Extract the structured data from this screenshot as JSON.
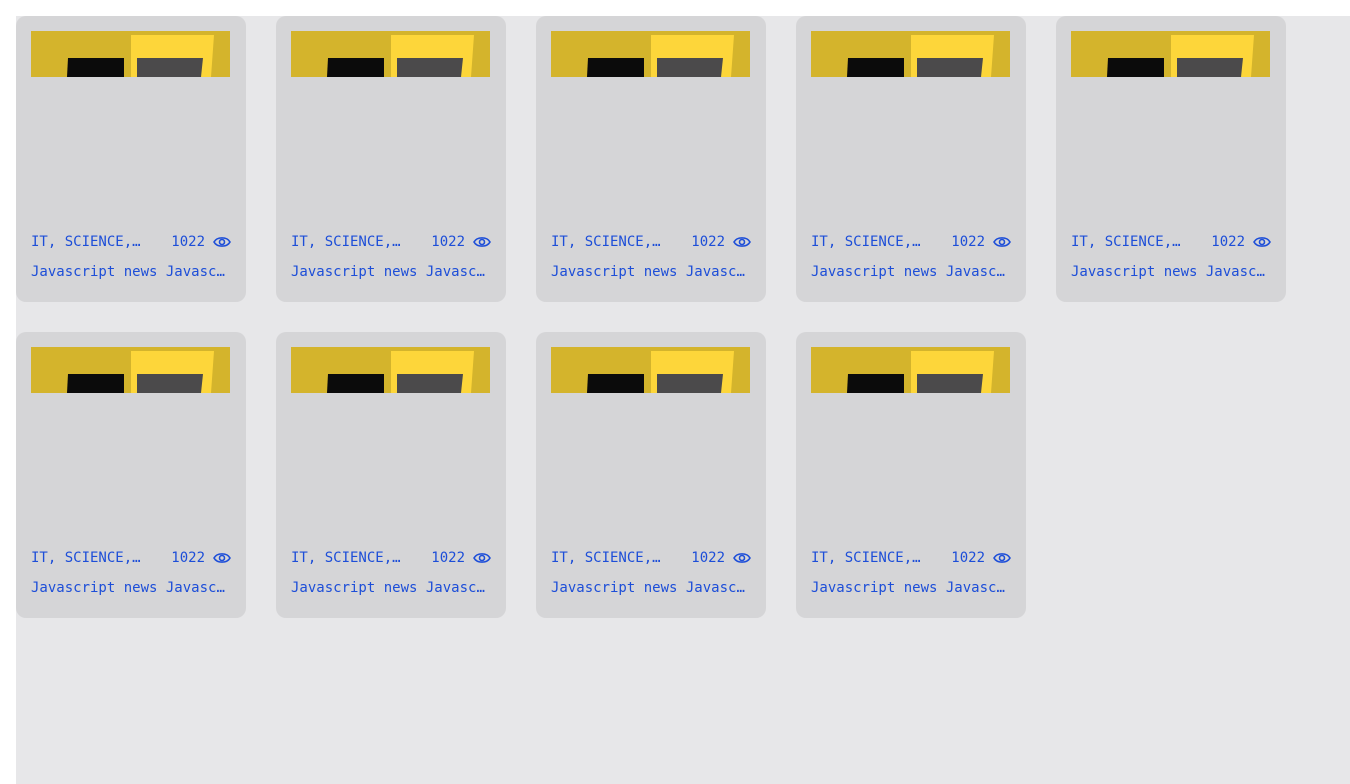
{
  "colors": {
    "background": "#e7e7e9",
    "card": "#d5d5d7",
    "text_link": "#1d4ed8",
    "thumb_yellow_dark": "#d4b42c",
    "thumb_yellow_light": "#fdd63a",
    "thumb_black": "#0b0b0b",
    "thumb_gray": "#4b4a4b"
  },
  "icons": {
    "views": "eye-icon"
  },
  "cards": [
    {
      "tags": "IT, SCIENCE, JAVASCRIPT",
      "views": "1022",
      "title": "Javascript news Javascript news"
    },
    {
      "tags": "IT, SCIENCE, JAVASCRIPT",
      "views": "1022",
      "title": "Javascript news Javascript news"
    },
    {
      "tags": "IT, SCIENCE, JAVASCRIPT",
      "views": "1022",
      "title": "Javascript news Javascript news"
    },
    {
      "tags": "IT, SCIENCE, JAVASCRIPT",
      "views": "1022",
      "title": "Javascript news Javascript news"
    },
    {
      "tags": "IT, SCIENCE, JAVASCRIPT",
      "views": "1022",
      "title": "Javascript news Javascript news"
    },
    {
      "tags": "IT, SCIENCE, JAVASCRIPT",
      "views": "1022",
      "title": "Javascript news Javascript news"
    },
    {
      "tags": "IT, SCIENCE, JAVASCRIPT",
      "views": "1022",
      "title": "Javascript news Javascript news"
    },
    {
      "tags": "IT, SCIENCE, JAVASCRIPT",
      "views": "1022",
      "title": "Javascript news Javascript news"
    },
    {
      "tags": "IT, SCIENCE, JAVASCRIPT",
      "views": "1022",
      "title": "Javascript news Javascript news"
    }
  ]
}
